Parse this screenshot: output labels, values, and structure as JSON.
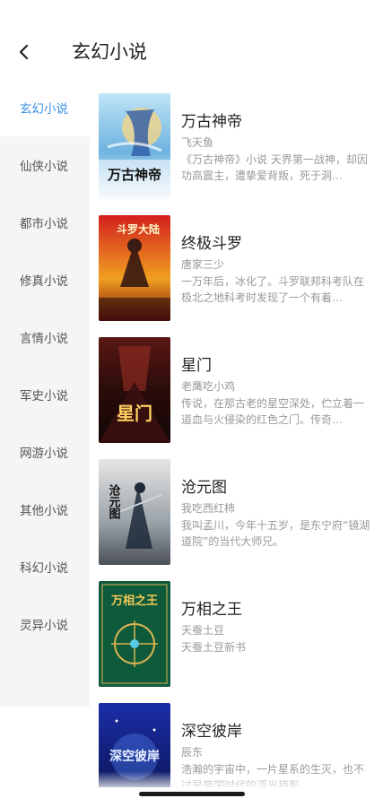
{
  "header": {
    "title": "玄幻小说"
  },
  "sidebar": {
    "items": [
      {
        "label": "玄幻小说",
        "active": true
      },
      {
        "label": "仙侠小说",
        "active": false
      },
      {
        "label": "都市小说",
        "active": false
      },
      {
        "label": "修真小说",
        "active": false
      },
      {
        "label": "言情小说",
        "active": false
      },
      {
        "label": "军史小说",
        "active": false
      },
      {
        "label": "网游小说",
        "active": false
      },
      {
        "label": "其他小说",
        "active": false
      },
      {
        "label": "科幻小说",
        "active": false
      },
      {
        "label": "灵异小说",
        "active": false
      }
    ]
  },
  "books": [
    {
      "title": "万古神帝",
      "author": "飞天鱼",
      "desc": "《万古神帝》小说 天界第一战神，却因功高震主，遭挚爱背叛，死于洞…",
      "cover_text": "万古神帝"
    },
    {
      "title": "终极斗罗",
      "author": "唐家三少",
      "desc": "一万年后，冰化了。斗罗联邦科考队在极北之地科考时发现了一个有着…",
      "cover_text": "斗罗大陆"
    },
    {
      "title": "星门",
      "author": "老鹰吃小鸡",
      "desc": "传说，在那古老的星空深处，伫立着一道血与火侵染的红色之门。传奇…",
      "cover_text": "星门"
    },
    {
      "title": "沧元图",
      "author": "我吃西红柿",
      "desc": "我叫孟川，今年十五岁，是东宁府“镜湖道院”的当代大师兄。",
      "cover_text": "沧元图"
    },
    {
      "title": "万相之王",
      "author": "天蚕土豆",
      "desc": "天蚕土豆新书",
      "cover_text": "万相之王"
    },
    {
      "title": "深空彼岸",
      "author": "辰东",
      "desc": "浩瀚的宇宙中，一片星系的生灭，也不过是帝国时代的浮光掠影…",
      "cover_text": "深空彼岸"
    }
  ],
  "colors": {
    "accent": "#3a8ee6",
    "sidebar_bg": "#f5f5f5"
  }
}
